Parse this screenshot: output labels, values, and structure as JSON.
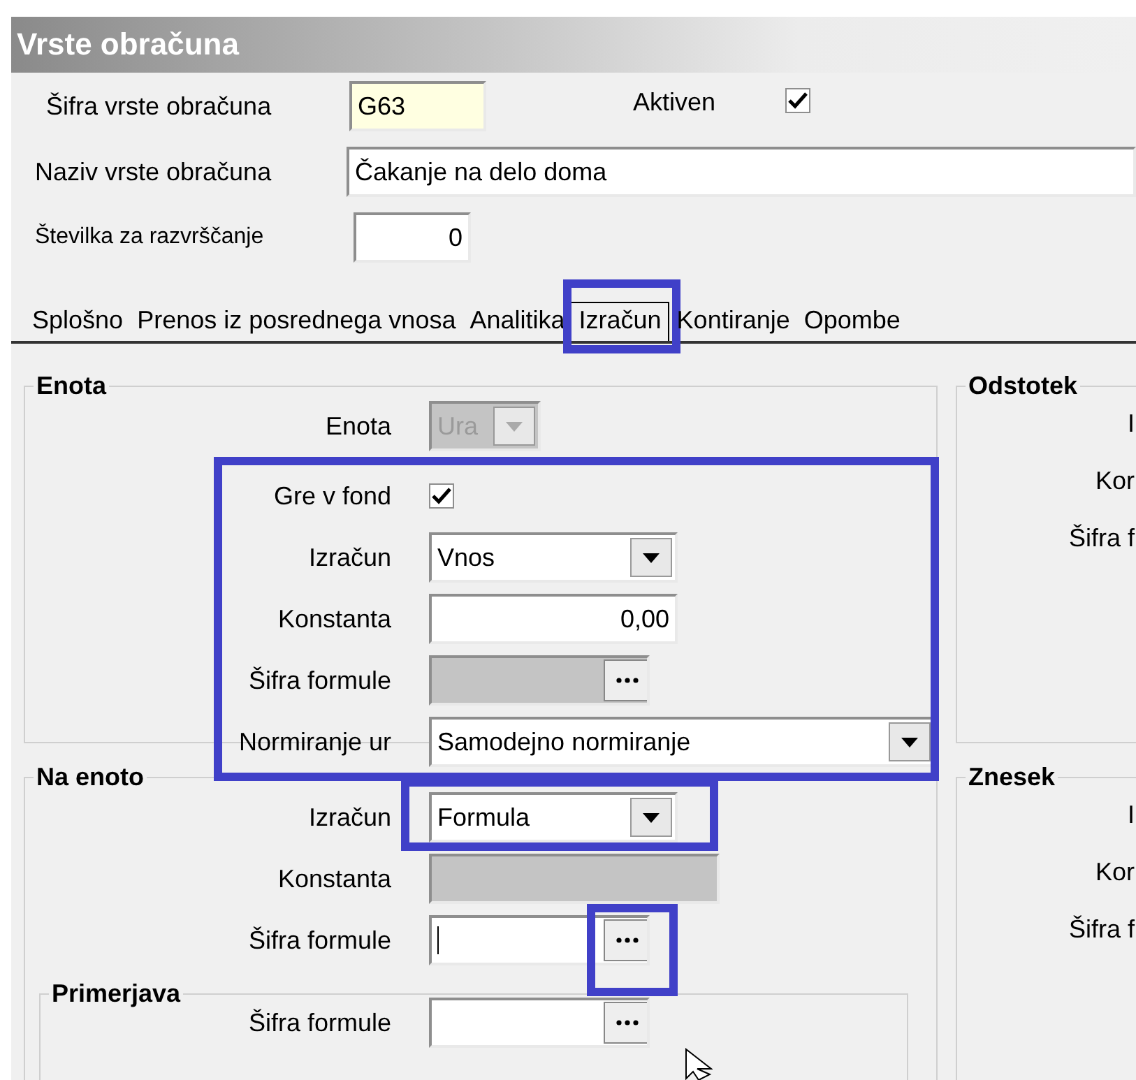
{
  "window": {
    "title": "Vrste obračuna"
  },
  "header": {
    "code": {
      "label": "Šifra vrste obračuna",
      "value": "G63"
    },
    "active": {
      "label": "Aktiven",
      "checked": true
    },
    "name": {
      "label": "Naziv vrste obračuna",
      "value": "Čakanje na delo doma"
    },
    "sort": {
      "label": "Številka  za razvrščanje",
      "value": "0"
    }
  },
  "tabs": [
    {
      "label": "Splošno",
      "selected": false,
      "highlighted": false
    },
    {
      "label": "Prenos iz posrednega vnosa",
      "selected": false,
      "highlighted": false
    },
    {
      "label": "Analitika",
      "selected": false,
      "highlighted": false
    },
    {
      "label": "Izračun",
      "selected": true,
      "highlighted": true
    },
    {
      "label": "Kontiranje",
      "selected": false,
      "highlighted": false
    },
    {
      "label": "Opombe",
      "selected": false,
      "highlighted": false
    }
  ],
  "enota": {
    "title": "Enota",
    "fields": [
      {
        "kind": "combo",
        "label": "Enota",
        "value": "Ura",
        "disabled": true
      }
    ],
    "boxed_fields": {
      "highlighted": true,
      "fields": [
        {
          "kind": "checkbox",
          "label": "Gre v fond",
          "checked": true
        },
        {
          "kind": "combo",
          "label": "Izračun",
          "value": "Vnos",
          "disabled": false
        },
        {
          "kind": "number",
          "label": "Konstanta",
          "value": "0,00",
          "disabled": false
        },
        {
          "kind": "lookup",
          "label": "Šifra formule",
          "disabled": true
        },
        {
          "kind": "wide_combo",
          "label": "Normiranje ur",
          "value": "Samodejno normiranje",
          "disabled": false
        }
      ]
    }
  },
  "odstotek": {
    "title": "Odstotek",
    "labels": [
      "I",
      "Kor",
      "Šifra f"
    ]
  },
  "na_enoto": {
    "title": "Na enoto",
    "fields": [
      {
        "kind": "combo",
        "label": "Izračun",
        "value": "Formula",
        "disabled": false,
        "highlighted": true
      },
      {
        "kind": "wide_number",
        "label": "Konstanta",
        "disabled": true
      },
      {
        "kind": "lookup",
        "label": "Šifra formule",
        "disabled": false,
        "focused": true,
        "highlighted": true
      }
    ],
    "primerjava": {
      "title": "Primerjava",
      "fields": [
        {
          "kind": "lookup",
          "label": "Šifra formule",
          "disabled": false
        }
      ]
    }
  },
  "znesek": {
    "title": "Znesek",
    "labels": [
      "I",
      "Kor",
      "Šifra f"
    ]
  }
}
